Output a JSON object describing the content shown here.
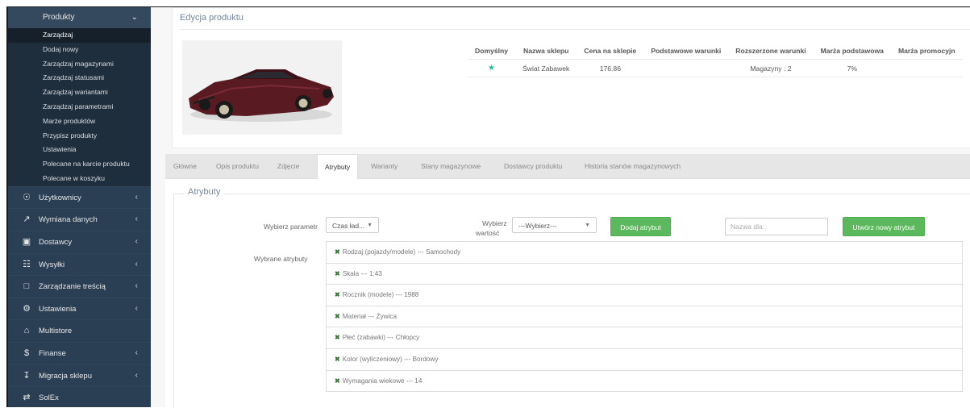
{
  "sidebar": {
    "section": {
      "label": "Produkty",
      "chevron": "chevron-down-icon"
    },
    "sub_items": [
      {
        "label": "Zarządzaj",
        "active": true
      },
      {
        "label": "Dodaj nowy"
      },
      {
        "label": "Zarządzaj magazynami"
      },
      {
        "label": "Zarządzaj statusami"
      },
      {
        "label": "Zarządzaj wariantami"
      },
      {
        "label": "Zarządzaj parametrami"
      },
      {
        "label": "Marże produktów"
      },
      {
        "label": "Przypisz produkty"
      },
      {
        "label": "Ustawienia"
      },
      {
        "label": "Polecane na karcie produktu"
      },
      {
        "label": "Polecane w koszyku"
      }
    ],
    "items": [
      {
        "label": "Użytkownicy",
        "icon": "user-icon",
        "chevron": true
      },
      {
        "label": "Wymiana danych",
        "icon": "external-link-icon",
        "chevron": true
      },
      {
        "label": "Dostawcy",
        "icon": "truck-icon",
        "chevron": true
      },
      {
        "label": "Wysyłki",
        "icon": "shipping-icon",
        "chevron": true
      },
      {
        "label": "Zarządzanie treścią",
        "icon": "comment-icon",
        "chevron": true
      },
      {
        "label": "Ustawienia",
        "icon": "gear-icon",
        "chevron": true
      },
      {
        "label": "Multistore",
        "icon": "home-icon",
        "chevron": false
      },
      {
        "label": "Finanse",
        "icon": "dollar-icon",
        "chevron": true
      },
      {
        "label": "Migracja sklepu",
        "icon": "download-icon",
        "chevron": true
      },
      {
        "label": "SolEx",
        "icon": "shuffle-icon",
        "chevron": false
      }
    ]
  },
  "header": {
    "title": "Edycja produktu"
  },
  "shops_table": {
    "columns": [
      "Domyślny",
      "Nazwa sklepu",
      "Cena na sklepie",
      "Podstawowe warunki",
      "Rozszerzone warunki",
      "Marża podstawowa",
      "Marża promocyjn"
    ],
    "rows": [
      {
        "default_icon": "star-icon",
        "shop": "Świat Zabawek",
        "price": "176.86",
        "basic": "",
        "extended": "Magazyny : 2",
        "margin": "7%",
        "promo": ""
      }
    ]
  },
  "tabs": [
    "Główne",
    "Opis produktu",
    "Zdjęcie",
    "Atrybuty",
    "Warianty",
    "Stany magazynowe",
    "Dostawcy produktu",
    "Historia stanów magazynowych"
  ],
  "active_tab": "Atrybuty",
  "attributes": {
    "legend": "Atrybuty",
    "param_label": "Wybierz parametr",
    "param_value": "Czas ład...",
    "value_label_1": "Wybierz",
    "value_label_2": "wartość",
    "value_select": "---Wybierz---",
    "add_button": "Dodaj atrybut",
    "name_placeholder": "Nazwa dla:",
    "create_button": "Utwórz nowy atrybut",
    "selected_label": "Wybrane atrybuty",
    "selected": [
      "Rodzaj (pojazdy/modele) --- Samochody",
      "Skala --- 1:43",
      "Rocznik (modele) --- 1988",
      "Materiał --- Żywica",
      "Płeć (zabawki) --- Chłopcy",
      "Kolor (wyliczeniowy) --- Bordowy",
      "Wymagania wiekowe --- 14"
    ]
  }
}
